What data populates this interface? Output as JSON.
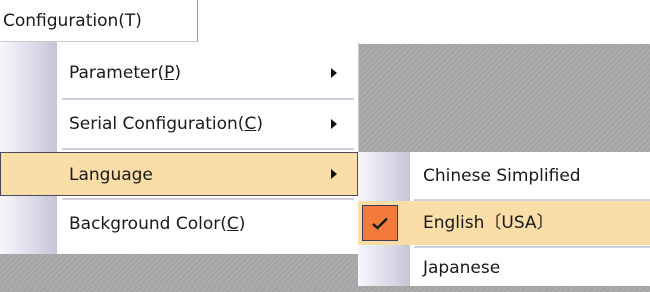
{
  "menubar": {
    "title": "Configuration(T)"
  },
  "menu": {
    "items": [
      {
        "prefix": "Parameter(",
        "mnemonic": "P",
        "suffix": ")",
        "has_submenu": true
      },
      {
        "prefix": "Serial Configuration(",
        "mnemonic": "C",
        "suffix": ")",
        "has_submenu": true
      },
      {
        "prefix": "Language",
        "mnemonic": "",
        "suffix": "",
        "has_submenu": true,
        "highlighted": true
      },
      {
        "prefix": "Background Color(",
        "mnemonic": "C",
        "suffix": ")",
        "has_submenu": false
      }
    ]
  },
  "language_submenu": {
    "items": [
      {
        "label": "Chinese Simplified",
        "checked": false
      },
      {
        "label": "English〔USA〕",
        "checked": true,
        "highlighted": true
      },
      {
        "label": "Japanese",
        "checked": false
      }
    ]
  },
  "colors": {
    "highlight": "#fbdda8",
    "check_bg": "#f27b3b",
    "gutter_dark": "#c4c4d6",
    "desktop": "#a9a9a9"
  },
  "icons": {
    "submenu_arrow": "triangle-right",
    "check": "checkmark"
  }
}
